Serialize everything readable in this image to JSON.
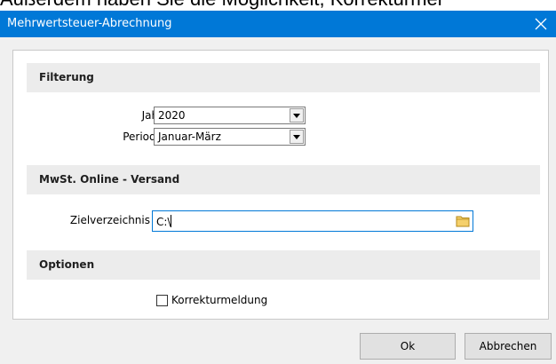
{
  "background_text": "Außerdem haben Sie die Möglichkeit, Korrekturmel",
  "window": {
    "title": "Mehrwertsteuer-Abrechnung",
    "close_glyph": "✕"
  },
  "sections": {
    "filter": {
      "header": "Filterung"
    },
    "online": {
      "header": "MwSt. Online - Versand"
    },
    "options": {
      "header": "Optionen"
    }
  },
  "fields": {
    "jahr": {
      "label": "Jahr",
      "value": "2020"
    },
    "periode": {
      "label": "Periode",
      "value": "Januar-März"
    },
    "zielverzeichnis": {
      "label": "Zielverzeichnis",
      "value": "C:\\"
    }
  },
  "options": {
    "korrekturmeldung": {
      "label": "Korrekturmeldung",
      "checked": false
    }
  },
  "buttons": {
    "ok": "Ok",
    "cancel": "Abbrechen"
  },
  "colors": {
    "accent": "#0078d7",
    "folder": "#e8c24a"
  }
}
